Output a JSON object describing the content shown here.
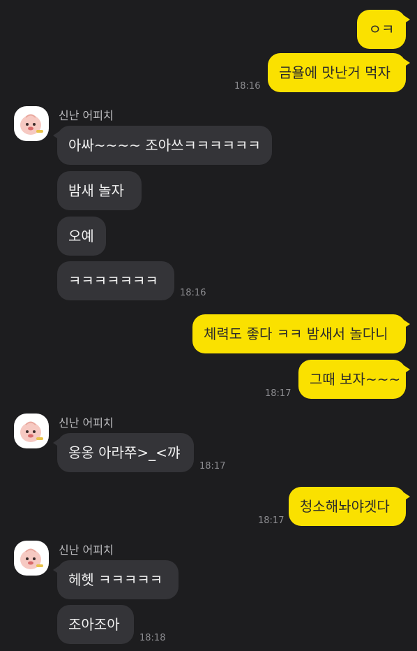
{
  "contact": {
    "name": "신난 어피치"
  },
  "messages": [
    {
      "text": "ㅇㅋ",
      "sender": "me"
    },
    {
      "text": "금욜에 맛난거 먹자",
      "sender": "me",
      "time": "18:16"
    },
    {
      "text": "아싸~~~~ 조아쓰ㅋㅋㅋㅋㅋㅋ",
      "sender": "other"
    },
    {
      "text": "밤새 놀자",
      "sender": "other"
    },
    {
      "text": "오예",
      "sender": "other"
    },
    {
      "text": "ㅋㅋㅋㅋㅋㅋㅋ",
      "sender": "other",
      "time": "18:16"
    },
    {
      "text": "체력도 좋다 ㅋㅋ 밤새서 놀다니",
      "sender": "me"
    },
    {
      "text": "그때 보자~~~",
      "sender": "me",
      "time": "18:17"
    },
    {
      "text": "옹옹 아라쭈>_<꺄",
      "sender": "other",
      "time": "18:17"
    },
    {
      "text": "청소해놔야겟다",
      "sender": "me",
      "time": "18:17"
    },
    {
      "text": "헤헷 ㅋㅋㅋㅋㅋ",
      "sender": "other"
    },
    {
      "text": "조아조아",
      "sender": "other",
      "time": "18:18"
    }
  ],
  "colors": {
    "background": "#1d1d1f",
    "my_bubble": "#fae100",
    "other_bubble": "#343438"
  },
  "icons": {
    "avatar": "apeach-profile-icon"
  }
}
